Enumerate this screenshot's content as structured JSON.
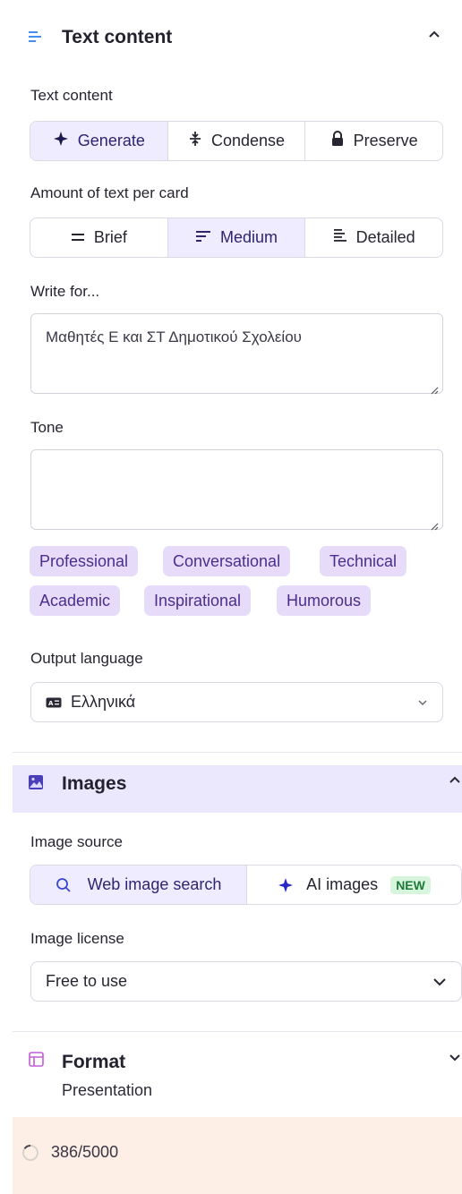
{
  "text_section": {
    "title": "Text content",
    "mode_label": "Text content",
    "modes": [
      "Generate",
      "Condense",
      "Preserve"
    ],
    "active_mode": "Generate",
    "amount_label": "Amount of text per card",
    "amounts": [
      "Brief",
      "Medium",
      "Detailed"
    ],
    "active_amount": "Medium",
    "audience_label": "Write for...",
    "audience_value": "Μαθητές Ε και ΣΤ Δημοτικού Σχολείου",
    "tone_label": "Tone",
    "tone_value": "",
    "tone_chips": [
      "Professional",
      "Conversational",
      "Technical",
      "Academic",
      "Inspirational",
      "Humorous"
    ],
    "language_label": "Output language",
    "language_value": "Ελληνικά"
  },
  "images_section": {
    "title": "Images",
    "source_label": "Image source",
    "sources": [
      "Web image search",
      "AI images"
    ],
    "active_source": "Web image search",
    "new_badge": "NEW",
    "license_label": "Image license",
    "license_value": "Free to use"
  },
  "format_section": {
    "title": "Format",
    "value": "Presentation"
  },
  "footer": {
    "counter": "386/5000"
  },
  "colors": {
    "accent": "#2e2470",
    "active_bg": "#efecff",
    "chip_bg": "#e6dcfa",
    "images_header_bg": "#ebe7fd",
    "footer_bg": "#fdeee6"
  }
}
